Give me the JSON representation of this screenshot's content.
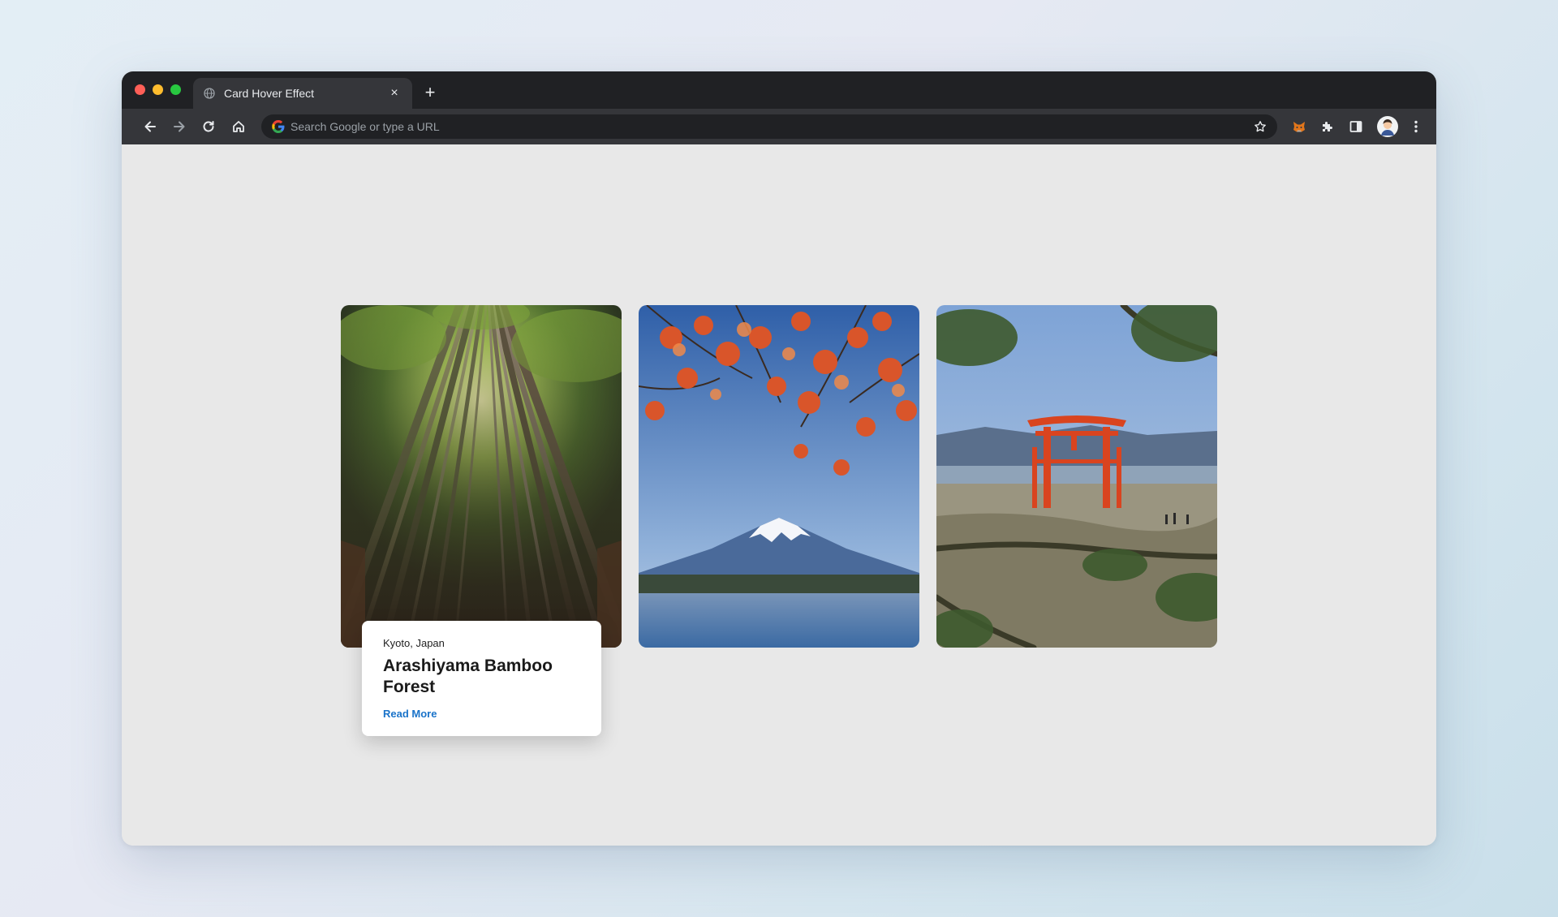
{
  "browser": {
    "tab_title": "Card Hover Effect",
    "tab_close": "×",
    "new_tab": "+",
    "address_placeholder": "Search Google or type a URL"
  },
  "cards": [
    {
      "location": "Kyoto, Japan",
      "title": "Arashiyama Bamboo Forest",
      "link": "Read More",
      "image": "bamboo-forest",
      "active": true
    },
    {
      "image": "mount-fuji-maple",
      "active": false
    },
    {
      "image": "itsukushima-torii",
      "active": false
    }
  ],
  "colors": {
    "link": "#1a73c9",
    "chrome_dark": "#202124",
    "chrome_mid": "#35363a",
    "page_bg": "#e8e8e8"
  }
}
